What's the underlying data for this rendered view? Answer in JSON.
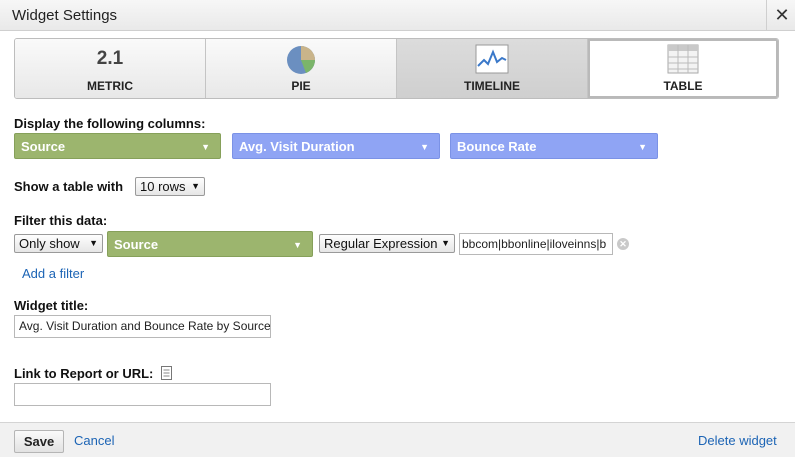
{
  "dialog": {
    "title": "Widget Settings",
    "close_glyph": "✕"
  },
  "widget_types": [
    {
      "label": "METRIC",
      "icon_text": "2.1"
    },
    {
      "label": "PIE"
    },
    {
      "label": "TIMELINE"
    },
    {
      "label": "TABLE"
    }
  ],
  "columns": {
    "label": "Display the following columns:",
    "dimension": "Source",
    "metric1": "Avg. Visit Duration",
    "metric2": "Bounce Rate"
  },
  "rows": {
    "label": "Show a table with",
    "value": "10 rows"
  },
  "filter": {
    "label": "Filter this data:",
    "mode": "Only show",
    "dimension": "Source",
    "match_type": "Regular Expression",
    "expression": "bbcom|bbonline|iloveinns|b",
    "add_label": "Add a filter"
  },
  "widget_title": {
    "label": "Widget title:",
    "value": "Avg. Visit Duration and Bounce Rate by Source"
  },
  "link": {
    "label": "Link to Report or URL:",
    "value": ""
  },
  "footer": {
    "save": "Save",
    "cancel": "Cancel",
    "delete": "Delete widget"
  },
  "colors": {
    "dimension_green": "#9cb56e",
    "metric_blue": "#8fa4f4",
    "link_blue": "#1c64b5"
  },
  "selected_type": "TABLE"
}
